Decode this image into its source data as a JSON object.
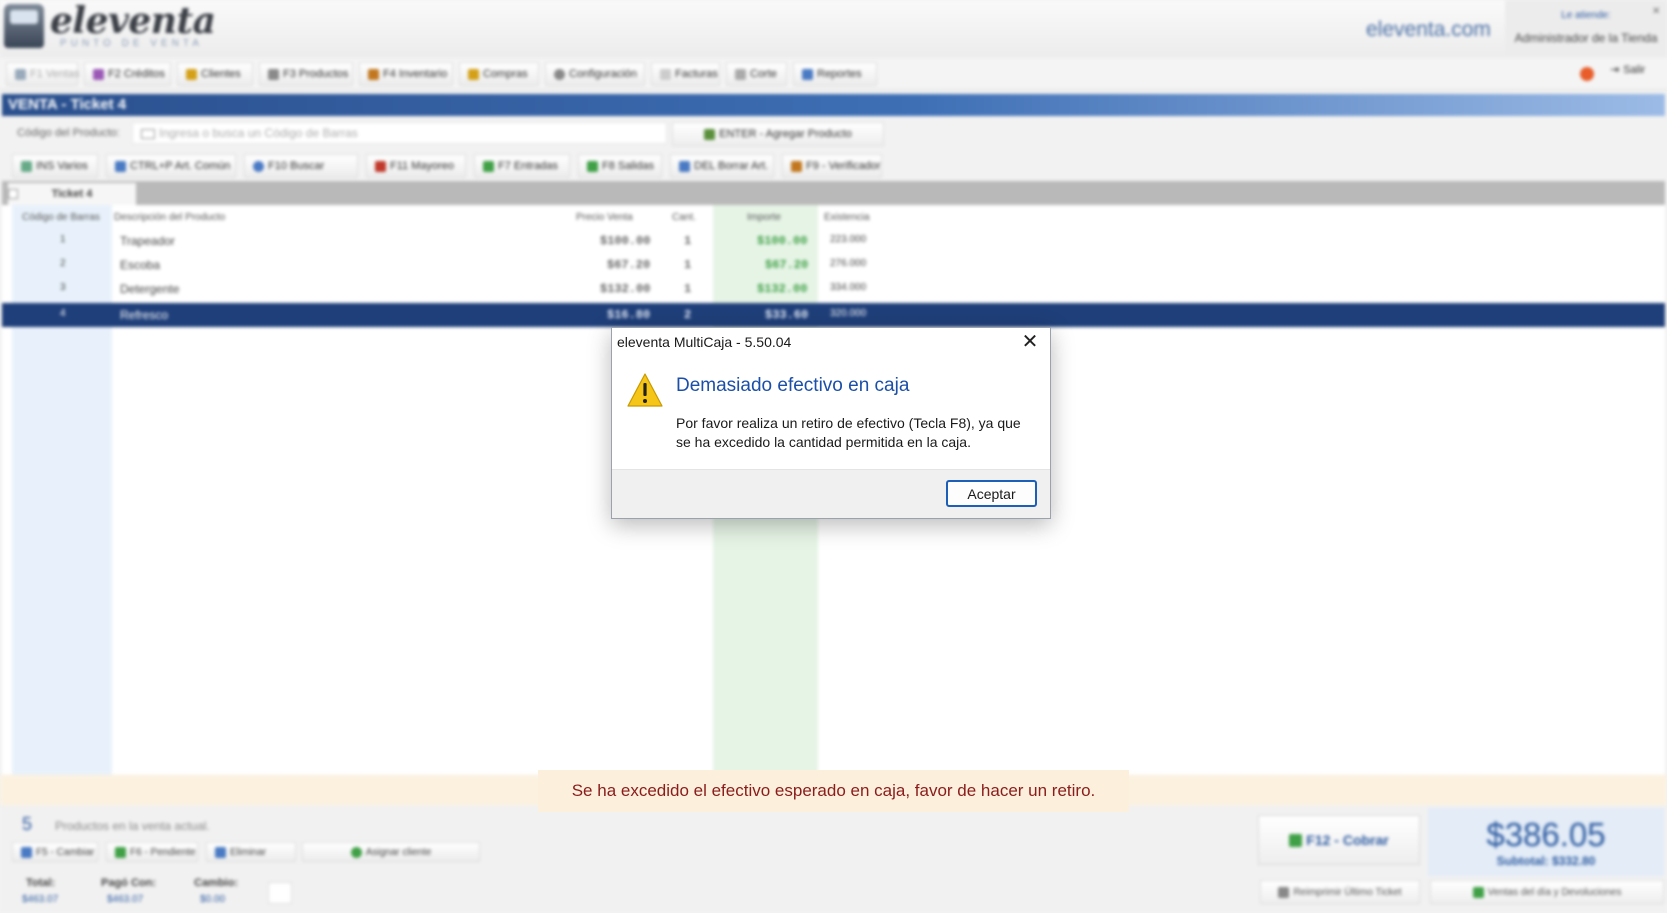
{
  "header": {
    "brand": "eleventa",
    "tagline": "PUNTO DE VENTA",
    "site": "eleventa.com",
    "attended_label": "Le atiende:",
    "attended_name": "Administrador de la Tienda"
  },
  "toolbar": {
    "items": [
      {
        "label": "F1 Ventas"
      },
      {
        "label": "F2 Créditos"
      },
      {
        "label": "Clientes"
      },
      {
        "label": "F3 Productos"
      },
      {
        "label": "F4 Inventario"
      },
      {
        "label": "Compras"
      },
      {
        "label": "Configuración"
      },
      {
        "label": "Facturas"
      },
      {
        "label": "Corte"
      },
      {
        "label": "Reportes"
      }
    ],
    "exit": "Salir"
  },
  "title": "VENTA - Ticket 4",
  "code": {
    "label": "Código del Producto:",
    "placeholder": "Ingresa o busca un Código de Barras",
    "enter_button": "ENTER - Agregar Producto"
  },
  "actions": [
    {
      "label": "INS Varios"
    },
    {
      "label": "CTRL+P Art. Común"
    },
    {
      "label": "F10 Buscar"
    },
    {
      "label": "F11 Mayoreo"
    },
    {
      "label": "F7 Entradas"
    },
    {
      "label": "F8 Salidas"
    },
    {
      "label": "DEL Borrar Art."
    },
    {
      "label": "F9 - Verificador"
    }
  ],
  "tab": {
    "label": "Ticket 4"
  },
  "table": {
    "headers": {
      "code": "Código de Barras",
      "description": "Descripción del Producto",
      "price": "Precio Venta",
      "qty": "Cant.",
      "amount": "Importe",
      "stock": "Existencia"
    },
    "rows": [
      {
        "code": "1",
        "description": "Trapeador",
        "price": "$100.00",
        "qty": "1",
        "amount": "$100.00",
        "stock": "223.000"
      },
      {
        "code": "2",
        "description": "Escoba",
        "price": "$67.20",
        "qty": "1",
        "amount": "$67.20",
        "stock": "276.000"
      },
      {
        "code": "3",
        "description": "Detergente",
        "price": "$132.00",
        "qty": "1",
        "amount": "$132.00",
        "stock": "334.000"
      },
      {
        "code": "4",
        "description": "Refresco",
        "price": "$16.80",
        "qty": "2",
        "amount": "$33.60",
        "stock": "320.000"
      }
    ]
  },
  "dialog": {
    "title": "eleventa MultiCaja - 5.50.04",
    "heading": "Demasiado efectivo en caja",
    "message": "Por favor realiza un retiro de efectivo (Tecla F8), ya que se ha excedido la cantidad permitida en la caja.",
    "ok": "Aceptar"
  },
  "banner": "Se ha excedido el efectivo esperado en caja, favor de hacer un retiro.",
  "bottom": {
    "count": "5",
    "count_label": "Productos en la venta actual.",
    "buttons": [
      {
        "label": "F5 - Cambiar"
      },
      {
        "label": "F6 - Pendiente"
      },
      {
        "label": "Eliminar"
      },
      {
        "label": "Asignar cliente"
      }
    ],
    "summary": [
      {
        "label": "Total:",
        "value": "$463.07"
      },
      {
        "label": "Pagó Con:",
        "value": "$463.07"
      },
      {
        "label": "Cambio:",
        "value": "$0.00"
      }
    ],
    "charge": "F12 - Cobrar",
    "total": "$386.05",
    "subtotal": "Subtotal: $332.80",
    "reprint": "Reimprimir Último Ticket",
    "sales": "Ventas del día y Devoluciones"
  },
  "colors": {
    "accent": "#2c5aa0",
    "selected_row": "#1f3f7a",
    "warning_text": "#8a1c1c",
    "warning_bg": "#fcf0dc",
    "amount_green": "#3fa046"
  }
}
